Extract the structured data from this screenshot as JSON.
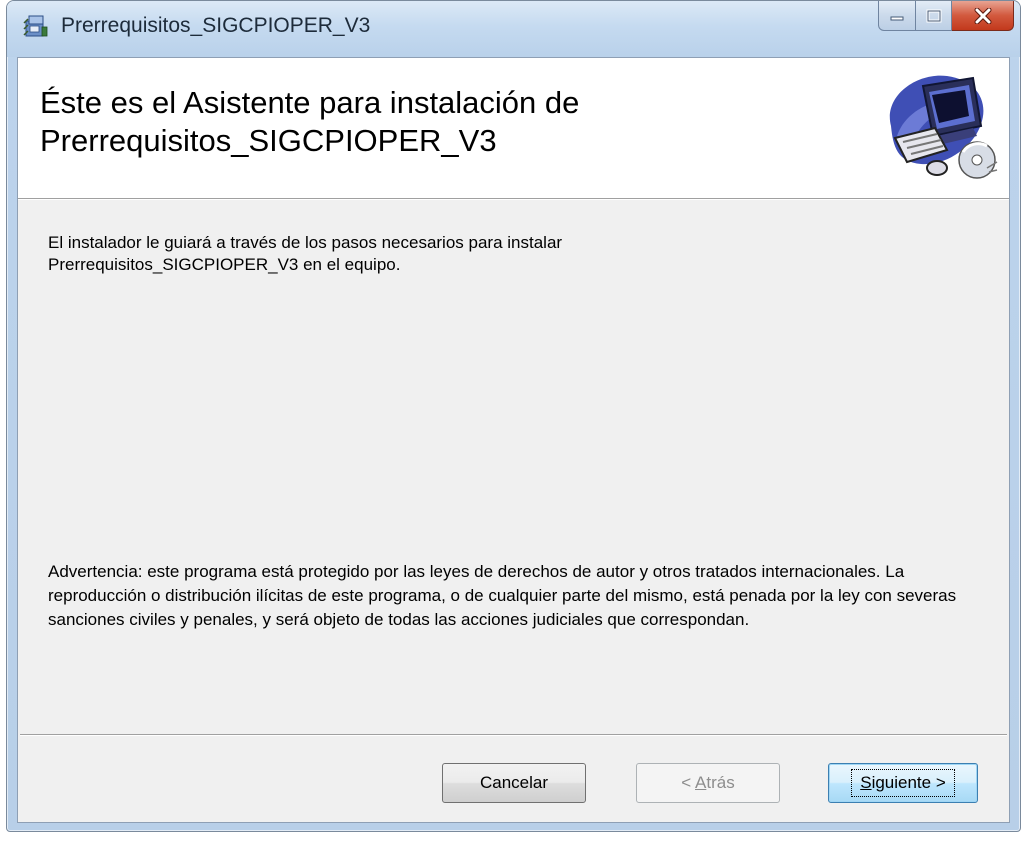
{
  "window": {
    "title": "Prerrequisitos_SIGCPIOPER_V3",
    "colors": {
      "close_button": "#c8452a",
      "titlebar": "#c5daf0",
      "client_background": "#f0f0f0",
      "banner_background": "#ffffff"
    },
    "caption_buttons": [
      "minimize-icon",
      "maximize-icon",
      "close-icon"
    ]
  },
  "banner": {
    "title": "Éste es el Asistente para instalación de Prerrequisitos_SIGCPIOPER_V3",
    "image_icon": "computer-setup-icon"
  },
  "body": {
    "intro": "El instalador le guiará a través de los pasos necesarios para instalar\nPrerrequisitos_SIGCPIOPER_V3 en el equipo.",
    "warning": "Advertencia: este programa está protegido por las leyes de derechos de autor y otros tratados internacionales. La reproducción o distribución ilícitas de este programa, o de cualquier parte del mismo, está penada por la ley con severas sanciones civiles y penales, y será objeto de todas las acciones judiciales que correspondan."
  },
  "buttons": {
    "cancel": "Cancelar",
    "back_arrow": "< ",
    "back_accel": "A",
    "back_rest": "trás",
    "next_accel": "S",
    "next_rest": "iguiente >"
  }
}
